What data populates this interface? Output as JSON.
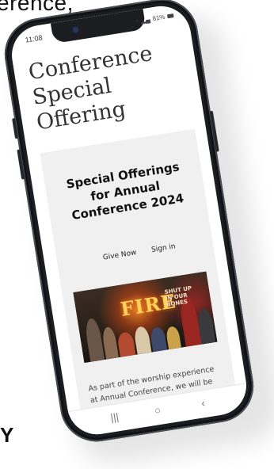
{
  "background_text": {
    "top": "erence,",
    "bottom": "Y"
  },
  "status_bar": {
    "time": "11:08",
    "battery": "81%",
    "icons": [
      "wifi-icon",
      "signal-icon",
      "battery-icon"
    ]
  },
  "page": {
    "title": "Conference\nSpecial\nOffering"
  },
  "card": {
    "title": "Special Offerings for Annual Conference 2024",
    "give_now": "Give Now",
    "sign_in": "Sign in",
    "hero_fire": "FIRE",
    "hero_caption": "SHUT UP\nIN OUR\nBONES",
    "body": "As part of the worship experience at Annual Conference, we will be taking electronic offerings to"
  },
  "nav_bar": {
    "recent": "|||",
    "home": "○",
    "back": "‹"
  }
}
